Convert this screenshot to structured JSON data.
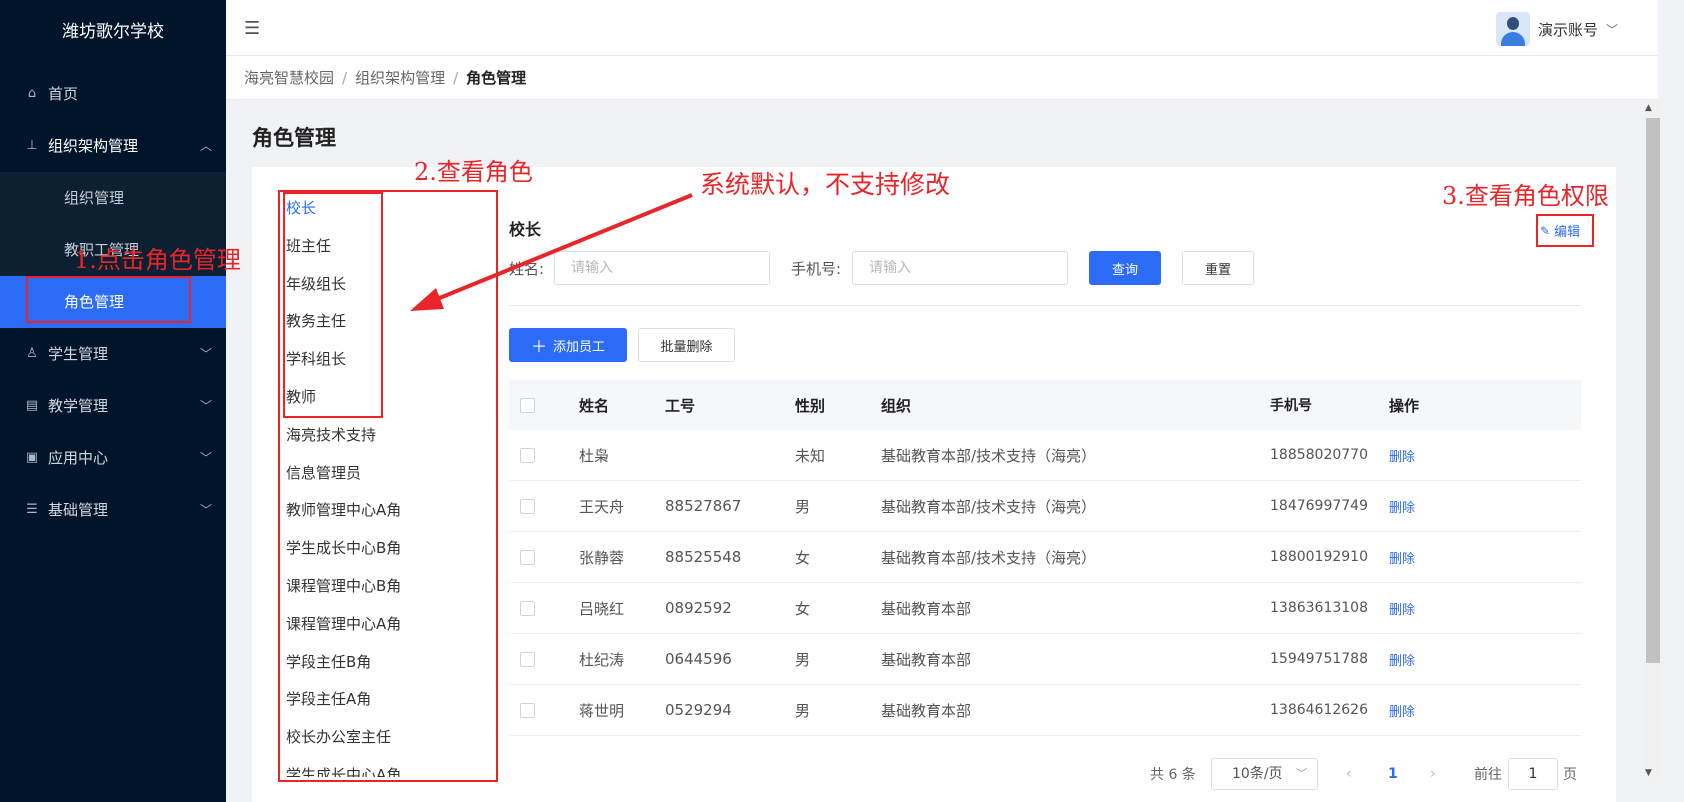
{
  "sidebar": {
    "logo": "潍坊歌尔学校",
    "home": {
      "label": "首页",
      "icon": "home-icon"
    },
    "org": {
      "label": "组织架构管理",
      "icon": "org-chart-icon",
      "children": [
        "组织管理",
        "教职工管理",
        "角色管理"
      ]
    },
    "student": {
      "label": "学生管理",
      "icon": "student-icon"
    },
    "teaching": {
      "label": "教学管理",
      "icon": "book-icon"
    },
    "apps": {
      "label": "应用中心",
      "icon": "app-icon"
    },
    "basic": {
      "label": "基础管理",
      "icon": "sliders-icon"
    }
  },
  "header": {
    "user_name": "演示账号",
    "menu_icon": "menu-fold-icon"
  },
  "breadcrumb": [
    "海亮智慧校园",
    "组织架构管理",
    "角色管理"
  ],
  "page": {
    "title": "角色管理"
  },
  "roles": [
    "校长",
    "班主任",
    "年级组长",
    "教务主任",
    "学科组长",
    "教师",
    "海亮技术支持",
    "信息管理员",
    "教师管理中心A角",
    "学生成长中心B角",
    "课程管理中心B角",
    "课程管理中心A角",
    "学段主任B角",
    "学段主任A角",
    "校长办公室主任",
    "学生成长中心A角"
  ],
  "detail": {
    "role_name": "校长",
    "edit_label": "编辑",
    "search": {
      "name_label": "姓名:",
      "name_placeholder": "请输入",
      "phone_label": "手机号:",
      "phone_placeholder": "请输入",
      "query_label": "查询",
      "reset_label": "重置"
    },
    "add_label": "添加员工",
    "batch_delete_label": "批量删除",
    "columns": [
      "姓名",
      "工号",
      "性别",
      "组织",
      "手机号",
      "操作"
    ],
    "rows": [
      {
        "name": "杜枭",
        "no": "",
        "sex": "未知",
        "org": "基础教育本部/技术支持（海亮）",
        "phone": "18858020770",
        "op": "删除"
      },
      {
        "name": "王天舟",
        "no": "88527867",
        "sex": "男",
        "org": "基础教育本部/技术支持（海亮）",
        "phone": "18476997749",
        "op": "删除"
      },
      {
        "name": "张静蓉",
        "no": "88525548",
        "sex": "女",
        "org": "基础教育本部/技术支持（海亮）",
        "phone": "18800192910",
        "op": "删除"
      },
      {
        "name": "吕晓红",
        "no": "0892592",
        "sex": "女",
        "org": "基础教育本部",
        "phone": "13863613108",
        "op": "删除"
      },
      {
        "name": "杜纪涛",
        "no": "0644596",
        "sex": "男",
        "org": "基础教育本部",
        "phone": "15949751788",
        "op": "删除"
      },
      {
        "name": "蒋世明",
        "no": "0529294",
        "sex": "男",
        "org": "基础教育本部",
        "phone": "13864612626",
        "op": "删除"
      }
    ],
    "pagination": {
      "total": "共 6 条",
      "page_size": "10条/页",
      "current": "1",
      "goto_label": "前往",
      "goto_value": "1",
      "page_unit": "页"
    }
  },
  "annotations": {
    "step1": "1.点击角色管理",
    "step2": "2.查看角色",
    "step3": "3.查看角色权限",
    "note": "系统默认，不支持修改"
  },
  "colors": {
    "sidebar_bg": "#001529",
    "primary": "#2b6bf6",
    "annotation": "#e8262a"
  }
}
